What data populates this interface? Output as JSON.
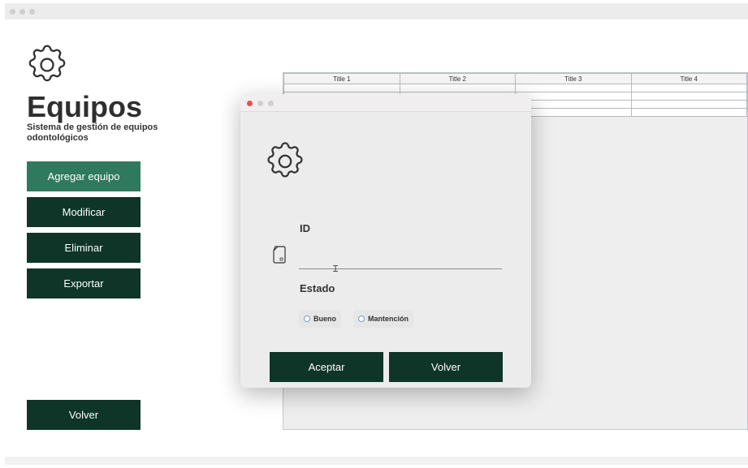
{
  "app": {
    "title": "Equipos",
    "subtitle": "Sistema de gestión de equipos odontológicos"
  },
  "sidebar": {
    "buttons": [
      {
        "label": "Agregar equipo"
      },
      {
        "label": "Modificar"
      },
      {
        "label": "Eliminar"
      },
      {
        "label": "Exportar"
      }
    ],
    "back_label": "Volver"
  },
  "table": {
    "headers": [
      "Title 1",
      "Title 2",
      "Title 3",
      "Title 4"
    ]
  },
  "dialog": {
    "id_label": "ID",
    "id_value": "",
    "estado_label": "Estado",
    "options": [
      {
        "label": "Bueno",
        "selected": false
      },
      {
        "label": "Mantención",
        "selected": false
      }
    ],
    "accept_label": "Aceptar",
    "back_label": "Volver"
  },
  "colors": {
    "primary": "#0e3528",
    "primary_active": "#2f7a5e",
    "close_red": "#e5504f"
  },
  "icons": {
    "app": "gear-icon",
    "dialog": "gear-icon",
    "field": "document-icon"
  }
}
